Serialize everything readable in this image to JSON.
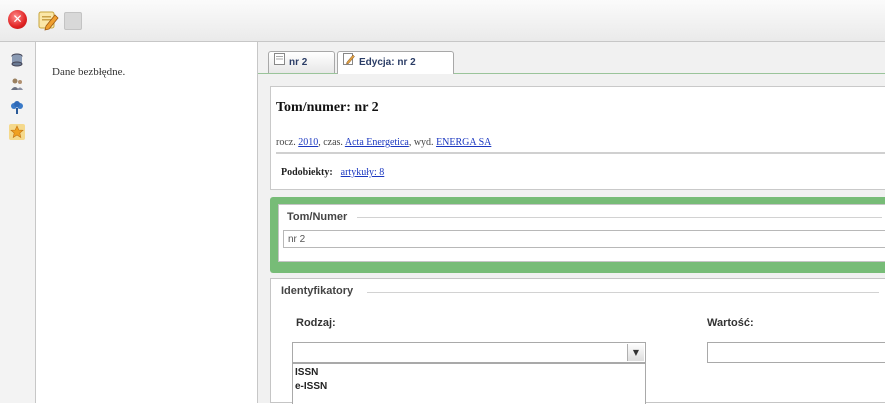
{
  "toolbar": {
    "close_icon": "close-icon",
    "edit_icon": "edit-icon",
    "disabled_icon": "disabled-icon"
  },
  "sidebar": {
    "items": [
      {
        "icon": "database-icon"
      },
      {
        "icon": "people-icon"
      },
      {
        "icon": "tree-icon"
      },
      {
        "icon": "star-icon"
      }
    ]
  },
  "messages": {
    "text": "Dane bezbłędne."
  },
  "tabs": [
    {
      "label": "nr 2"
    },
    {
      "label": "Edycja: nr 2"
    }
  ],
  "header": {
    "title": "Tom/numer: nr 2",
    "meta_prefix_year": "rocz. ",
    "year": "2010",
    "meta_journal_prefix": ", czas. ",
    "journal": "Acta Energetica",
    "meta_publisher_prefix": ", wyd. ",
    "publisher": "ENERGA SA",
    "subobjects_label": "Podobiekty:",
    "subobjects_link": "artykuły: 8"
  },
  "tom_numer": {
    "legend": "Tom/Numer",
    "value": "nr 2"
  },
  "identyfikatory": {
    "legend": "Identyfikatory",
    "rodzaj_label": "Rodzaj:",
    "wartosc_label": "Wartość:",
    "rodzaj_value": "",
    "wartosc_value": "",
    "options": [
      "ISSN",
      "e-ISSN"
    ]
  },
  "colors": {
    "accent_green": "#77bc77",
    "link_blue": "#1a37c0",
    "close_red": "#e02424"
  }
}
